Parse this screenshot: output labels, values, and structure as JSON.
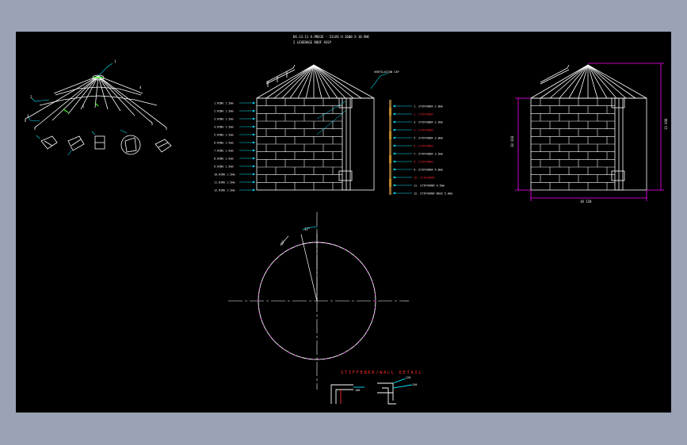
{
  "drawing": {
    "background": "#000000",
    "frame_color": "#9aa3b5",
    "colors": {
      "white": "#ffffff",
      "cyan": "#00e5ff",
      "red": "#ff2a2a",
      "magenta": "#ff00ff",
      "green": "#39ff14",
      "orange": "#c48a2a"
    },
    "title_line1": "DA.13.11 A.PROJE - SILOS H 1600 X 10 RHC",
    "title_line2": "2 LEVERAGE ROOF ASSY",
    "top_label": "VENTILATION CAP",
    "left_labels": [
      "1.RING 1.5mm",
      "2.RING 1.5mm",
      "3.RING 1.5mm",
      "4.RING 1.5mm",
      "5.RING 1.5mm",
      "6.RING 1.5mm",
      "7.RING 1.5mm",
      "8.RING 1.5mm",
      "9.RING 1.5mm",
      "10.RING 1.5mm",
      "11.RING 1.5mm",
      "12.RING 1.5mm"
    ],
    "right_labels": [
      {
        "text": "1. STIFFENER 2.0mm",
        "color": "white"
      },
      {
        "text": "2. STIFFENER",
        "color": "red"
      },
      {
        "text": "3. STIFFENER 2.5mm",
        "color": "white"
      },
      {
        "text": "4. STIFFENER",
        "color": "red"
      },
      {
        "text": "5. STIFFENER 3.0mm",
        "color": "white"
      },
      {
        "text": "6. STIFFENER",
        "color": "red"
      },
      {
        "text": "7. STIFFENER 3.5mm",
        "color": "white"
      },
      {
        "text": "8. STIFFENER",
        "color": "red"
      },
      {
        "text": "9. STIFFENER 4.0mm",
        "color": "white"
      },
      {
        "text": "10. STIFFENER",
        "color": "red"
      },
      {
        "text": "11. STIFFENER 4.5mm",
        "color": "white"
      },
      {
        "text": "12. STIFFENER BASE 5.0mm",
        "color": "white"
      }
    ],
    "dim_diameter": "10 110",
    "dim_height_eave": "10 010",
    "dim_height_total": "13 030",
    "angle_label": "12°",
    "small_label": "15°",
    "detail_title": "STIFFENER/WALL DETAIL",
    "detail_values": [
      "100",
      "120",
      "150"
    ],
    "part_labels": [
      "1",
      "2",
      "3",
      "4",
      "5"
    ]
  }
}
